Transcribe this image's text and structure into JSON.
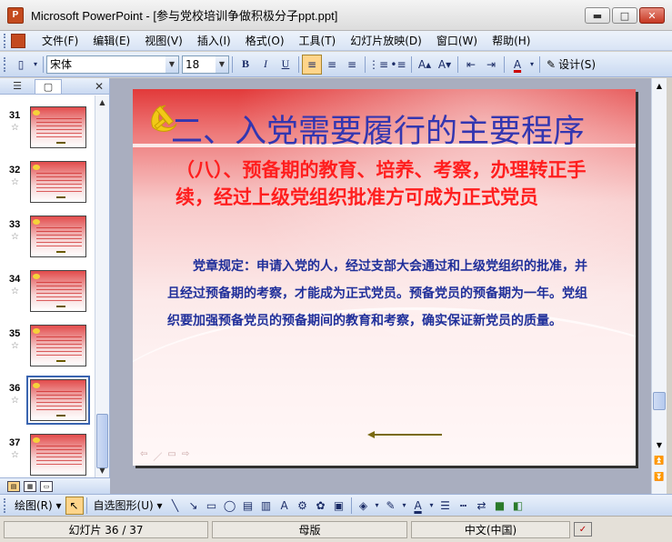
{
  "window": {
    "title": "Microsoft PowerPoint - [参与党校培训争做积极分子ppt.ppt]",
    "icon": "powerpoint-icon",
    "min_glyph": "▬",
    "max_glyph": "□",
    "close_glyph": "✕"
  },
  "menu": [
    "文件(F)",
    "编辑(E)",
    "视图(V)",
    "插入(I)",
    "格式(O)",
    "工具(T)",
    "幻灯片放映(D)",
    "窗口(W)",
    "帮助(H)"
  ],
  "toolbar": {
    "font_name": "宋体",
    "font_size": "18",
    "bold": "B",
    "italic": "I",
    "underline": "U",
    "design_label": "设计(S)"
  },
  "thumbnails": [
    {
      "num": "31"
    },
    {
      "num": "32"
    },
    {
      "num": "33"
    },
    {
      "num": "34"
    },
    {
      "num": "35"
    },
    {
      "num": "36"
    },
    {
      "num": "37"
    }
  ],
  "slide": {
    "title": "二、入党需要履行的主要程序",
    "subtitle": "（八）、预备期的教育、培养、考察，办理转正手续，经过上级党组织批准方可成为正式党员",
    "body": "　　党章规定：申请入党的人，经过支部大会通过和上级党组织的批准，并且经过预备期的考察，才能成为正式党员。预备党员的预备期为一年。党组织要加强预备党员的预备期间的教育和考察，确实保证新党员的质量。",
    "colors": {
      "title": "#3336b0",
      "subtitle": "#ff1e1e",
      "body": "#1f2f9a"
    }
  },
  "drawbar": {
    "draw_label": "绘图(R) ▾",
    "autoshape_label": "自选图形(U) ▾"
  },
  "status": {
    "slide_info": "幻灯片 36 / 37",
    "template": "母版",
    "language": "中文(中国)"
  },
  "pane_close": "✕"
}
